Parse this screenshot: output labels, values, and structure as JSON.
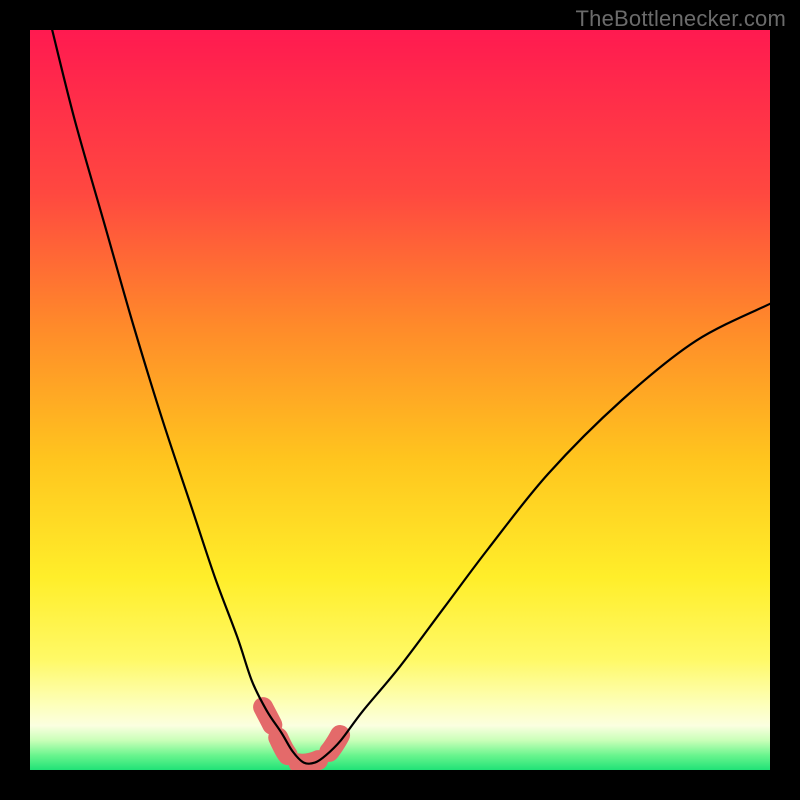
{
  "watermark": "TheBottlenecker.com",
  "colors": {
    "frame": "#000000",
    "top": "#ff1a50",
    "mid1": "#ff6a2a",
    "mid2": "#ffd21a",
    "mid3": "#ffff54",
    "pale": "#fbffc5",
    "bottom": "#22e578",
    "curve": "#000000",
    "marker": "#e46a6a"
  },
  "chart_data": {
    "type": "line",
    "title": "",
    "xlabel": "",
    "ylabel": "",
    "xlim": [
      0,
      100
    ],
    "ylim": [
      0,
      100
    ],
    "series": [
      {
        "name": "bottleneck-curve",
        "x": [
          3,
          6,
          10,
          14,
          18,
          22,
          25,
          28,
          30,
          32,
          34,
          35.5,
          37,
          38.5,
          40,
          42,
          45,
          50,
          56,
          62,
          70,
          80,
          90,
          100
        ],
        "y": [
          100,
          88,
          74,
          60,
          47,
          35,
          26,
          18,
          12,
          8,
          5,
          2.5,
          1,
          1,
          2,
          4,
          8,
          14,
          22,
          30,
          40,
          50,
          58,
          63
        ]
      }
    ],
    "markers": {
      "name": "highlight-band",
      "color": "#e46a6a",
      "points": [
        {
          "x": 31.5,
          "y": 8.5
        },
        {
          "x": 32.8,
          "y": 6
        },
        {
          "x": 34.5,
          "y": 2.5
        },
        {
          "x": 36,
          "y": 1
        },
        {
          "x": 38,
          "y": 1
        },
        {
          "x": 40,
          "y": 2
        },
        {
          "x": 41.5,
          "y": 4
        },
        {
          "x": 42.5,
          "y": 6
        }
      ]
    }
  }
}
